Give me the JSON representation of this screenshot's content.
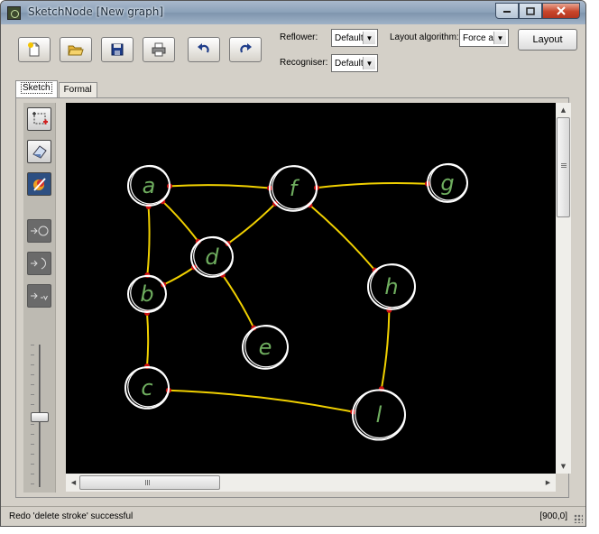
{
  "window": {
    "title": "SketchNode [New graph]",
    "buttons": [
      "minimize",
      "maximize",
      "close"
    ]
  },
  "toolbar": {
    "buttons": [
      {
        "name": "new",
        "icon": "new-file-icon"
      },
      {
        "name": "open",
        "icon": "open-folder-icon"
      },
      {
        "name": "save",
        "icon": "save-disk-icon"
      },
      {
        "name": "print",
        "icon": "printer-icon"
      },
      {
        "name": "undo",
        "icon": "undo-arrow-icon"
      },
      {
        "name": "redo",
        "icon": "redo-arrow-icon"
      }
    ],
    "reflower_label": "Reflower:",
    "reflower_value": "Default",
    "layout_algorithm_label": "Layout algorithm:",
    "layout_algorithm_value": "Force a",
    "recogniser_label": "Recogniser:",
    "recogniser_value": "Default",
    "layout_button": "Layout"
  },
  "tabs": [
    {
      "label": "Sketch",
      "active": true
    },
    {
      "label": "Formal",
      "active": false
    }
  ],
  "tools": [
    {
      "name": "select-region",
      "icon": "selection-crop-icon",
      "state": "enabled"
    },
    {
      "name": "erase",
      "icon": "eraser-icon",
      "state": "enabled"
    },
    {
      "name": "pen",
      "icon": "pen-color-icon",
      "state": "selected"
    },
    {
      "name": "add-node",
      "icon": "arrow-node-icon",
      "state": "disabled"
    },
    {
      "name": "add-arc",
      "icon": "arrow-arc-icon",
      "state": "disabled"
    },
    {
      "name": "add-text",
      "icon": "arrow-text-icon",
      "state": "disabled"
    }
  ],
  "zoom_slider_value": 0.55,
  "graph": {
    "node_color": "#ffffff",
    "label_color": "#6fae5f",
    "edge_color": "#f0d000",
    "endpoint_color": "#d01010",
    "nodes": [
      {
        "id": "a",
        "label": "a"
      },
      {
        "id": "b",
        "label": "b"
      },
      {
        "id": "c",
        "label": "c"
      },
      {
        "id": "d",
        "label": "d"
      },
      {
        "id": "e",
        "label": "e"
      },
      {
        "id": "f",
        "label": "f"
      },
      {
        "id": "g",
        "label": "g"
      },
      {
        "id": "h",
        "label": "h"
      },
      {
        "id": "i",
        "label": "l"
      }
    ],
    "edges": [
      [
        "a",
        "f"
      ],
      [
        "a",
        "b"
      ],
      [
        "a",
        "d"
      ],
      [
        "f",
        "g"
      ],
      [
        "f",
        "d"
      ],
      [
        "f",
        "h"
      ],
      [
        "d",
        "b"
      ],
      [
        "d",
        "e"
      ],
      [
        "b",
        "c"
      ],
      [
        "h",
        "i"
      ],
      [
        "c",
        "i"
      ]
    ]
  },
  "status": {
    "message": "Redo 'delete stroke' successful",
    "coords": "[900,0]"
  }
}
